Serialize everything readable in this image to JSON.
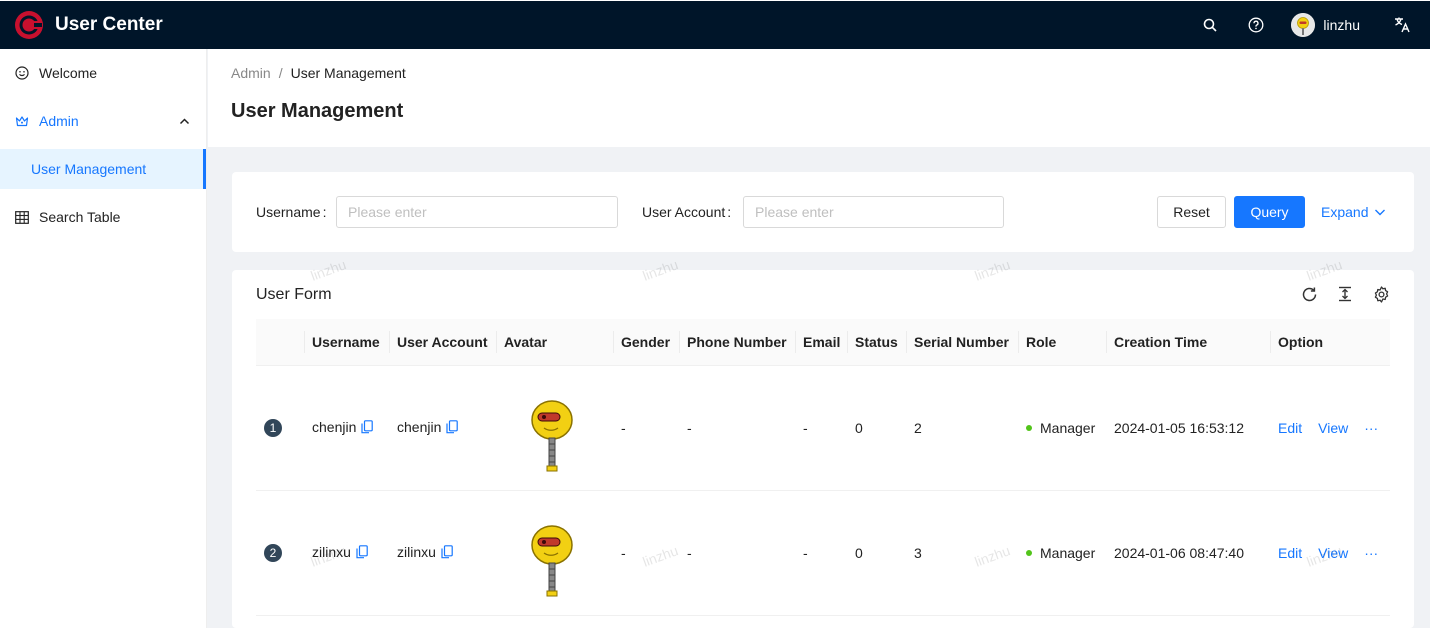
{
  "header": {
    "app_title": "User Center",
    "username": "linzhu",
    "icons": [
      "search-icon",
      "question-icon",
      "translate-icon"
    ],
    "bg_color": "#001529",
    "logo_color": "#c8102e"
  },
  "sidebar": {
    "items": [
      {
        "label": "Welcome",
        "icon": "smile-icon"
      },
      {
        "label": "Admin",
        "icon": "crown-icon",
        "expanded": true
      },
      {
        "label": "User Management",
        "selected": true
      },
      {
        "label": "Search Table",
        "icon": "table-icon"
      }
    ]
  },
  "breadcrumb": {
    "parent": "Admin",
    "separator": "/",
    "current": "User Management"
  },
  "page_title": "User Management",
  "search": {
    "username_label": "Username",
    "username_placeholder": "Please enter",
    "account_label": "User Account",
    "account_placeholder": "Please enter",
    "reset_label": "Reset",
    "query_label": "Query",
    "expand_label": "Expand"
  },
  "table": {
    "title": "User Form",
    "toolbar_icons": [
      "reload-icon",
      "density-icon",
      "settings-icon"
    ],
    "columns": [
      "",
      "Username",
      "User Account",
      "Avatar",
      "Gender",
      "Phone Number",
      "Email",
      "Status",
      "Serial Number",
      "Role",
      "Creation Time",
      "Option"
    ],
    "rows": [
      {
        "index": "1",
        "username": "chenjin",
        "account": "chenjin",
        "gender": "-",
        "phone": "-",
        "email": "-",
        "status": "0",
        "serial": "2",
        "role": "Manager",
        "created": "2024-01-05 16:53:12",
        "edit": "Edit",
        "view": "View",
        "more": "···"
      },
      {
        "index": "2",
        "username": "zilinxu",
        "account": "zilinxu",
        "gender": "-",
        "phone": "-",
        "email": "-",
        "status": "0",
        "serial": "3",
        "role": "Manager",
        "created": "2024-01-06 08:47:40",
        "edit": "Edit",
        "view": "View",
        "more": "···"
      }
    ]
  },
  "watermark": "linzhu",
  "accent_color": "#1677ff"
}
